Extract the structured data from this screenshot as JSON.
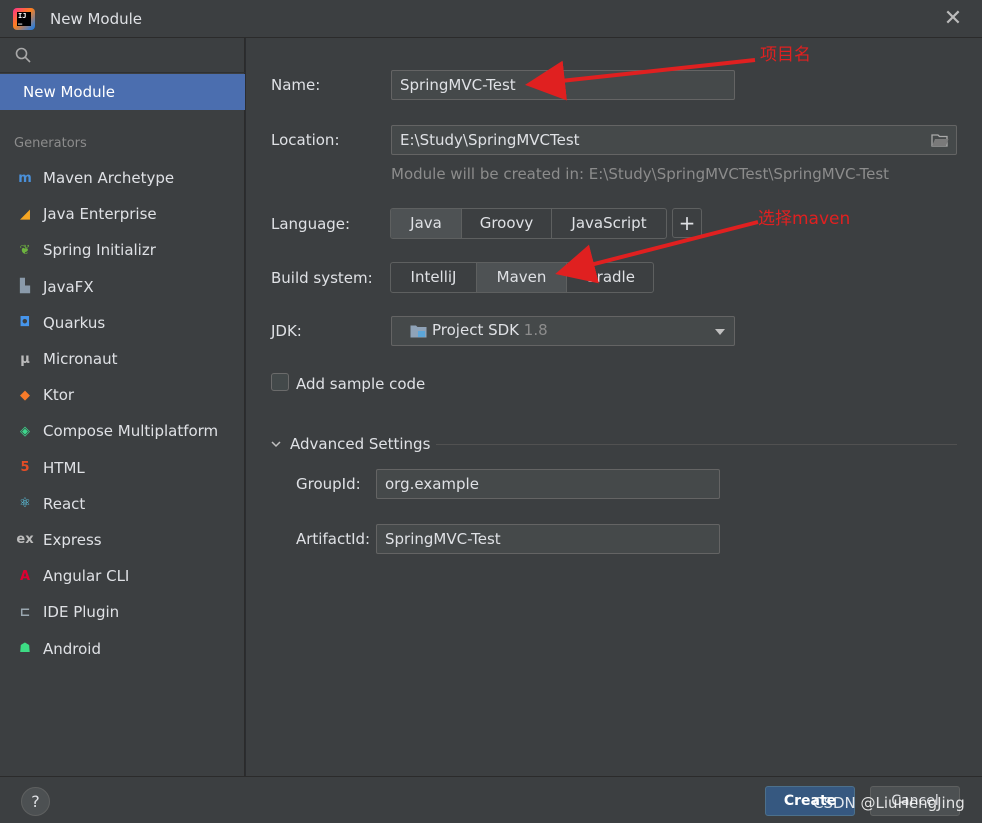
{
  "window": {
    "title": "New Module",
    "close_glyph": "✕"
  },
  "sidebar": {
    "search_icon": "search-icon",
    "selected": "New Module",
    "section_label": "Generators",
    "items": [
      {
        "label": "Maven Archetype",
        "icon": "maven-icon",
        "glyph": "m",
        "color": "#4a90d9"
      },
      {
        "label": "Java Enterprise",
        "icon": "java-enterprise-icon",
        "glyph": "◢",
        "color": "#f5a623"
      },
      {
        "label": "Spring Initializr",
        "icon": "spring-icon",
        "glyph": "❦",
        "color": "#6db33f"
      },
      {
        "label": "JavaFX",
        "icon": "javafx-icon",
        "glyph": "▙",
        "color": "#8a9aaa"
      },
      {
        "label": "Quarkus",
        "icon": "quarkus-icon",
        "glyph": "◘",
        "color": "#4695eb"
      },
      {
        "label": "Micronaut",
        "icon": "micronaut-icon",
        "glyph": "μ",
        "color": "#bbbbbb"
      },
      {
        "label": "Ktor",
        "icon": "ktor-icon",
        "glyph": "◆",
        "color": "#f77b2a"
      },
      {
        "label": "Compose Multiplatform",
        "icon": "compose-icon",
        "glyph": "◈",
        "color": "#3dd68c"
      },
      {
        "label": "HTML",
        "icon": "html-icon",
        "glyph": "5",
        "color": "#e44d26"
      },
      {
        "label": "React",
        "icon": "react-icon",
        "glyph": "⚛",
        "color": "#61dafb"
      },
      {
        "label": "Express",
        "icon": "express-icon",
        "glyph": "ex",
        "color": "#bbbbbb"
      },
      {
        "label": "Angular CLI",
        "icon": "angular-icon",
        "glyph": "A",
        "color": "#dd0031"
      },
      {
        "label": "IDE Plugin",
        "icon": "ide-plugin-icon",
        "glyph": "⊏",
        "color": "#9aa7b0"
      },
      {
        "label": "Android",
        "icon": "android-icon",
        "glyph": "☗",
        "color": "#3ddc84"
      }
    ]
  },
  "form": {
    "name_label": "Name:",
    "name_value": "SpringMVC-Test",
    "location_label": "Location:",
    "location_value": "E:\\Study\\SpringMVCTest",
    "location_hint": "Module will be created in: E:\\Study\\SpringMVCTest\\SpringMVC-Test",
    "language_label": "Language:",
    "languages": [
      "Java",
      "Groovy",
      "JavaScript"
    ],
    "language_selected": "Java",
    "add_glyph": "+",
    "build_label": "Build system:",
    "build_systems": [
      "IntelliJ",
      "Maven",
      "Gradle"
    ],
    "build_selected": "Maven",
    "jdk_label": "JDK:",
    "jdk_value": "Project SDK",
    "jdk_version": "1.8",
    "sample_code_label": "Add sample code",
    "sample_code_checked": false,
    "advanced_label": "Advanced Settings",
    "groupid_label": "GroupId:",
    "groupid_value": "org.example",
    "artifactid_label": "ArtifactId:",
    "artifactid_value": "SpringMVC-Test"
  },
  "footer": {
    "help_glyph": "?",
    "create_label": "Create",
    "cancel_label": "Cancel",
    "watermark": "CSDN @LiuHengJing"
  },
  "annotations": {
    "name_note": "项目名",
    "maven_note": "选择maven",
    "color": "#e02020"
  }
}
